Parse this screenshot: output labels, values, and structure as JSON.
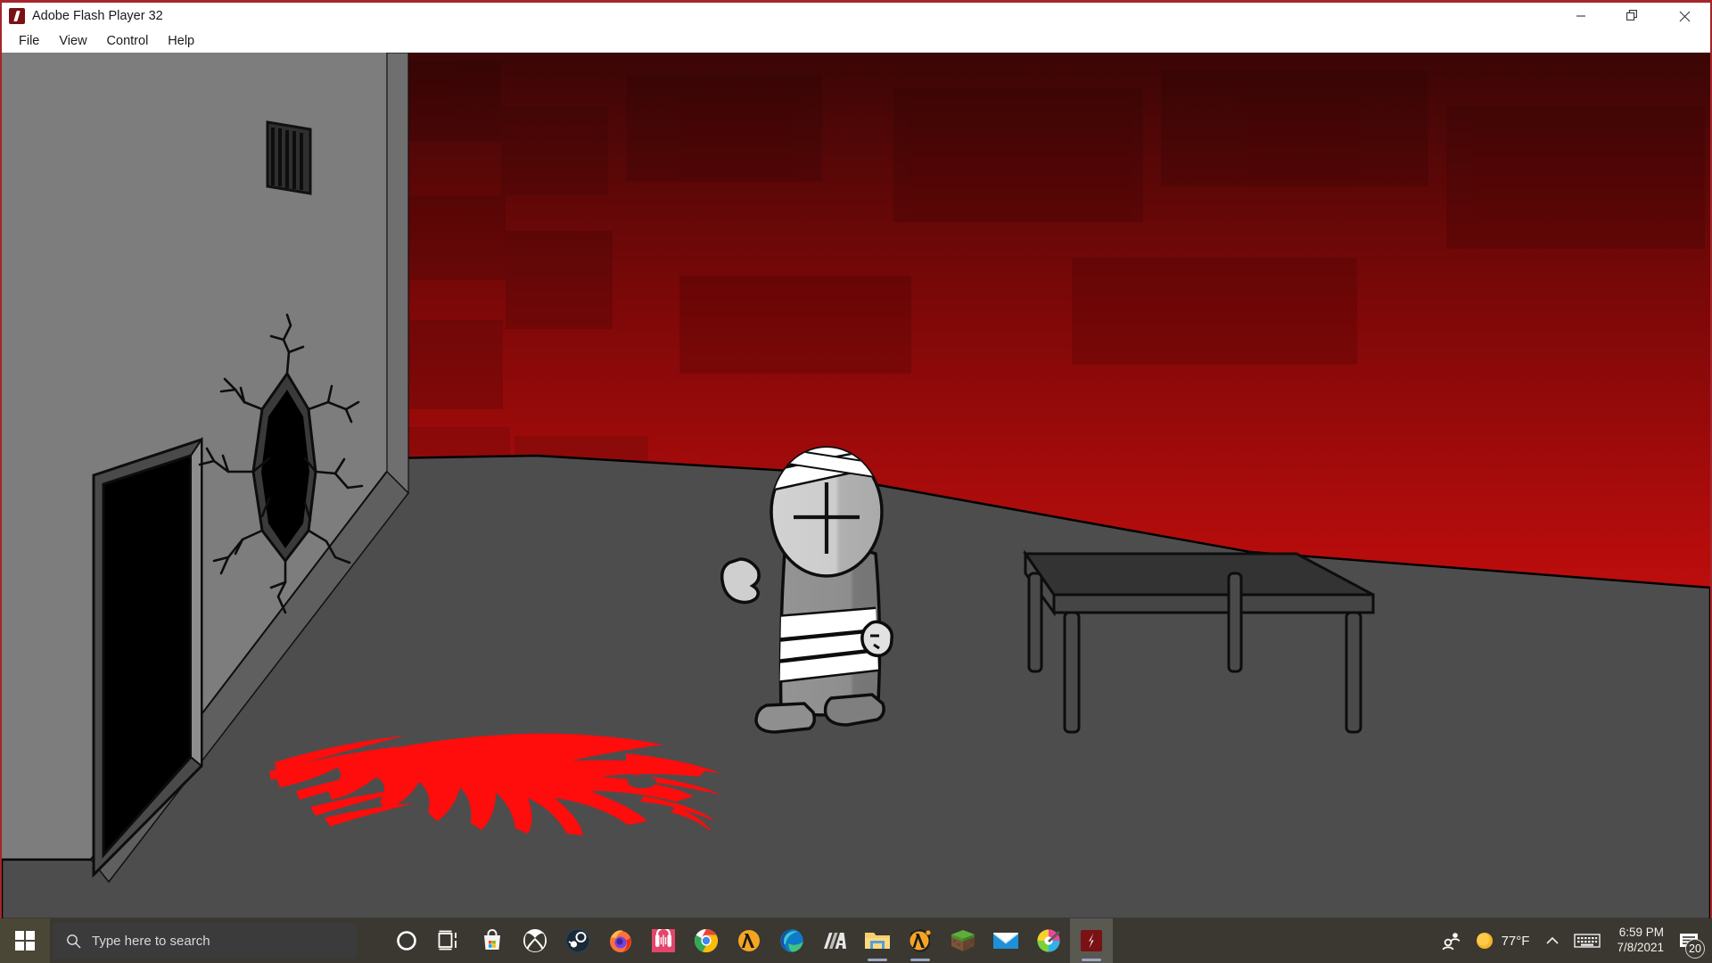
{
  "window": {
    "title": "Adobe Flash Player 32",
    "icon": "flash-logo-icon",
    "accent_red": "#a4262c",
    "controls": {
      "minimize": "minimize-icon",
      "maximize": "maximize-restore-icon",
      "close": "close-icon"
    },
    "menu": [
      {
        "label": "File"
      },
      {
        "label": "View"
      },
      {
        "label": "Control"
      },
      {
        "label": "Help"
      }
    ]
  },
  "stage": {
    "description": "Flash animation scene: grey room interior with dark red back wall, open doorway and cracked hole in left wall, bandaged stick figure, table and red blood splatter on floor",
    "colors": {
      "floor": "#4d4d4d",
      "left_wall": "#7d7d7d",
      "left_wall_edge": "#6a6a6a",
      "back_wall_top": "#380505",
      "back_wall_bottom": "#b80c0c",
      "blood": "#ff0c0c",
      "table_top": "#3a3a3a",
      "table_side": "#4a4a4a",
      "character_skin": "#c9c9c9",
      "character_body": "#8f8f8f",
      "bandage": "#ffffff",
      "outline": "#000000",
      "doorway": "#000000",
      "hole": "#000000"
    },
    "objects": [
      {
        "name": "wall-vent",
        "label": "vent grate"
      },
      {
        "name": "doorway",
        "label": "open doorway"
      },
      {
        "name": "wall-hole",
        "label": "cracked hole in wall"
      },
      {
        "name": "character",
        "label": "bandaged stick figure"
      },
      {
        "name": "left-hand",
        "label": "detached left hand"
      },
      {
        "name": "right-hand",
        "label": "detached right hand"
      },
      {
        "name": "table",
        "label": "table"
      },
      {
        "name": "blood-splatter",
        "label": "blood splatter"
      }
    ]
  },
  "taskbar": {
    "start": "windows-start-icon",
    "search": {
      "icon": "search-icon",
      "placeholder": "Type here to search",
      "value": ""
    },
    "items": [
      {
        "name": "cortana",
        "label": "Cortana",
        "icon": "cortana-icon",
        "active": false,
        "open": false
      },
      {
        "name": "task-view",
        "label": "Task View",
        "icon": "task-view-icon",
        "active": false,
        "open": false
      },
      {
        "name": "microsoft-store",
        "label": "Microsoft Store",
        "icon": "microsoft-store-icon",
        "active": false,
        "open": false
      },
      {
        "name": "xbox",
        "label": "Xbox",
        "icon": "xbox-icon",
        "active": false,
        "open": false
      },
      {
        "name": "steam",
        "label": "Steam",
        "icon": "steam-icon",
        "active": false,
        "open": false
      },
      {
        "name": "firefox",
        "label": "Firefox",
        "icon": "firefox-icon",
        "active": false,
        "open": false
      },
      {
        "name": "audacity",
        "label": "Audacity",
        "icon": "audacity-icon",
        "active": false,
        "open": false
      },
      {
        "name": "chrome",
        "label": "Google Chrome",
        "icon": "chrome-icon",
        "active": false,
        "open": false
      },
      {
        "name": "half-life",
        "label": "Half-Life",
        "icon": "lambda-icon",
        "active": false,
        "open": false
      },
      {
        "name": "edge",
        "label": "Microsoft Edge",
        "icon": "edge-icon",
        "active": false,
        "open": false
      },
      {
        "name": "multimc",
        "label": "MultiMC",
        "icon": "multimc-icon",
        "active": false,
        "open": false
      },
      {
        "name": "file-explorer",
        "label": "File Explorer",
        "icon": "folder-icon",
        "active": false,
        "open": true
      },
      {
        "name": "half-life-2",
        "label": "Half-Life 2",
        "icon": "lambda-badge-icon",
        "active": false,
        "open": true
      },
      {
        "name": "minecraft",
        "label": "Minecraft",
        "icon": "grass-block-icon",
        "active": false,
        "open": false
      },
      {
        "name": "mail",
        "label": "Mail",
        "icon": "envelope-icon",
        "active": false,
        "open": false
      },
      {
        "name": "paint-net",
        "label": "Paint.NET",
        "icon": "paint-dot-net-icon",
        "active": false,
        "open": false
      },
      {
        "name": "flash-player",
        "label": "Adobe Flash Player",
        "icon": "flash-logo-icon",
        "active": true,
        "open": true
      }
    ],
    "tray": {
      "people": "people-icon",
      "weather": {
        "icon": "sun-icon",
        "temperature": "77°F"
      },
      "show_hidden": "chevron-up-icon",
      "touch_keyboard": "keyboard-icon",
      "clock": {
        "time": "6:59 PM",
        "date": "7/8/2021"
      },
      "notifications": {
        "icon": "notification-icon",
        "count": "20"
      }
    }
  }
}
